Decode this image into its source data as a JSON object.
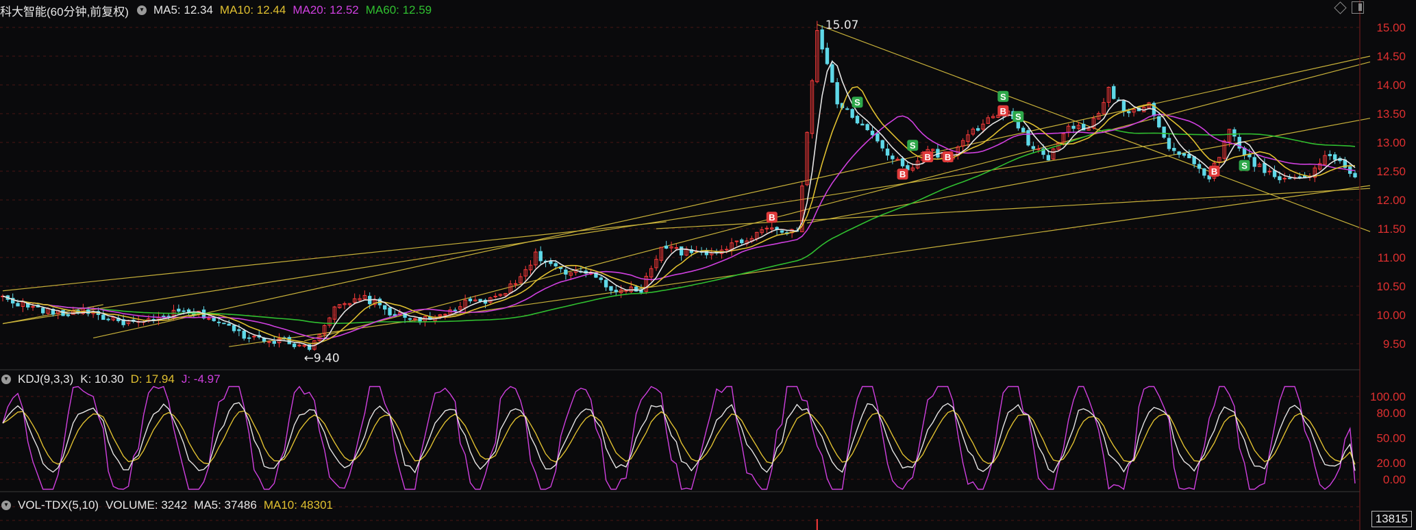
{
  "header": {
    "title": "科大智能(60分钟,前复权)",
    "indicators": [
      {
        "label": "MA5: 12.34",
        "color": "#e6e6e6"
      },
      {
        "label": "MA10: 12.44",
        "color": "#e0c030"
      },
      {
        "label": "MA20: 12.52",
        "color": "#d040e0"
      },
      {
        "label": "MA60: 12.59",
        "color": "#30c030"
      }
    ]
  },
  "kdj_header": {
    "title": "KDJ(9,3,3)",
    "indicators": [
      {
        "label": "K: 10.30",
        "color": "#e6e6e6"
      },
      {
        "label": "D: 17.94",
        "color": "#e0c030"
      },
      {
        "label": "J: -4.97",
        "color": "#d040e0"
      }
    ]
  },
  "vol_header": {
    "title": "VOL-TDX(5,10)",
    "indicators": [
      {
        "label": "VOLUME: 3242",
        "color": "#e6e6e6"
      },
      {
        "label": "MA5: 37486",
        "color": "#e6e6e6"
      },
      {
        "label": "MA10: 48301",
        "color": "#e0c030"
      }
    ]
  },
  "volume_box": "13815",
  "chart_data": [
    {
      "type": "candlestick",
      "name": "price",
      "y_ticks": [
        "15.00",
        "14.50",
        "14.00",
        "13.50",
        "13.00",
        "12.50",
        "12.00",
        "11.50",
        "11.00",
        "10.50",
        "10.00",
        "9.50"
      ],
      "ylim": [
        9.0,
        15.2
      ],
      "x_count": 270,
      "annotations": [
        {
          "label": "15.07",
          "x": 162,
          "y": 15.07
        },
        {
          "label": "←9.40",
          "x": 61,
          "y": 9.4
        }
      ],
      "signals": [
        {
          "type": "B",
          "x": 153,
          "y": 11.7
        },
        {
          "type": "S",
          "x": 170,
          "y": 13.7
        },
        {
          "type": "B",
          "x": 179,
          "y": 12.45
        },
        {
          "type": "S",
          "x": 181,
          "y": 12.95
        },
        {
          "type": "B",
          "x": 184,
          "y": 12.75
        },
        {
          "type": "B",
          "x": 188,
          "y": 12.75
        },
        {
          "type": "S",
          "x": 199,
          "y": 13.8
        },
        {
          "type": "B",
          "x": 199,
          "y": 13.55
        },
        {
          "type": "S",
          "x": 202,
          "y": 13.45
        },
        {
          "type": "B",
          "x": 241,
          "y": 12.5
        },
        {
          "type": "S",
          "x": 247,
          "y": 12.6
        }
      ],
      "trendlines": [
        [
          [
            0,
            10.42
          ],
          [
            132,
            11.62
          ]
        ],
        [
          [
            0,
            9.85
          ],
          [
            232,
            13.0
          ]
        ],
        [
          [
            0,
            9.85
          ],
          [
            20,
            10.18
          ]
        ],
        [
          [
            45,
            9.45
          ],
          [
            272,
            12.25
          ]
        ],
        [
          [
            60,
            9.55
          ],
          [
            272,
            14.4
          ]
        ],
        [
          [
            18,
            9.6
          ],
          [
            272,
            14.5
          ]
        ],
        [
          [
            130,
            11.5
          ],
          [
            272,
            12.2
          ]
        ],
        [
          [
            162,
            15.05
          ],
          [
            272,
            11.45
          ]
        ],
        [
          [
            160,
            11.6
          ],
          [
            272,
            13.42
          ]
        ]
      ],
      "anchors": [
        [
          0,
          10.3
        ],
        [
          5,
          10.15
        ],
        [
          12,
          10.0
        ],
        [
          16,
          10.1
        ],
        [
          22,
          9.9
        ],
        [
          28,
          9.85
        ],
        [
          35,
          10.05
        ],
        [
          40,
          10.0
        ],
        [
          48,
          9.65
        ],
        [
          55,
          9.55
        ],
        [
          61,
          9.45
        ],
        [
          66,
          10.1
        ],
        [
          72,
          10.3
        ],
        [
          78,
          10.0
        ],
        [
          85,
          9.9
        ],
        [
          92,
          10.2
        ],
        [
          97,
          10.25
        ],
        [
          102,
          10.55
        ],
        [
          106,
          11.05
        ],
        [
          112,
          10.7
        ],
        [
          117,
          10.75
        ],
        [
          122,
          10.4
        ],
        [
          127,
          10.45
        ],
        [
          131,
          11.2
        ],
        [
          135,
          11.1
        ],
        [
          140,
          11.05
        ],
        [
          146,
          11.25
        ],
        [
          153,
          11.55
        ],
        [
          158,
          11.4
        ],
        [
          162,
          14.95
        ],
        [
          166,
          13.7
        ],
        [
          172,
          13.2
        ],
        [
          176,
          12.8
        ],
        [
          180,
          12.5
        ],
        [
          184,
          12.9
        ],
        [
          188,
          12.7
        ],
        [
          192,
          13.1
        ],
        [
          196,
          13.4
        ],
        [
          200,
          13.5
        ],
        [
          204,
          13.0
        ],
        [
          208,
          12.7
        ],
        [
          212,
          13.3
        ],
        [
          216,
          13.2
        ],
        [
          220,
          13.9
        ],
        [
          224,
          13.5
        ],
        [
          228,
          13.7
        ],
        [
          232,
          12.9
        ],
        [
          236,
          12.7
        ],
        [
          240,
          12.4
        ],
        [
          244,
          13.2
        ],
        [
          248,
          12.7
        ],
        [
          254,
          12.35
        ],
        [
          260,
          12.45
        ],
        [
          264,
          12.8
        ],
        [
          270,
          12.34
        ]
      ],
      "ma_colors": {
        "ma5": "#e6e6e6",
        "ma10": "#e0c030",
        "ma20": "#d040e0",
        "ma60": "#30c030"
      },
      "up_color": "#ff3b3b",
      "down_color": "#5fd8e8"
    },
    {
      "type": "line",
      "name": "kdj",
      "y_ticks": [
        "100.00",
        "80.00",
        "50.00",
        "20.00",
        "0.00"
      ],
      "ylim": [
        -15,
        115
      ],
      "series": [
        {
          "name": "K",
          "color": "#e6e6e6"
        },
        {
          "name": "D",
          "color": "#e0c030"
        },
        {
          "name": "J",
          "color": "#d040e0"
        }
      ]
    },
    {
      "type": "bar",
      "name": "volume"
    }
  ]
}
